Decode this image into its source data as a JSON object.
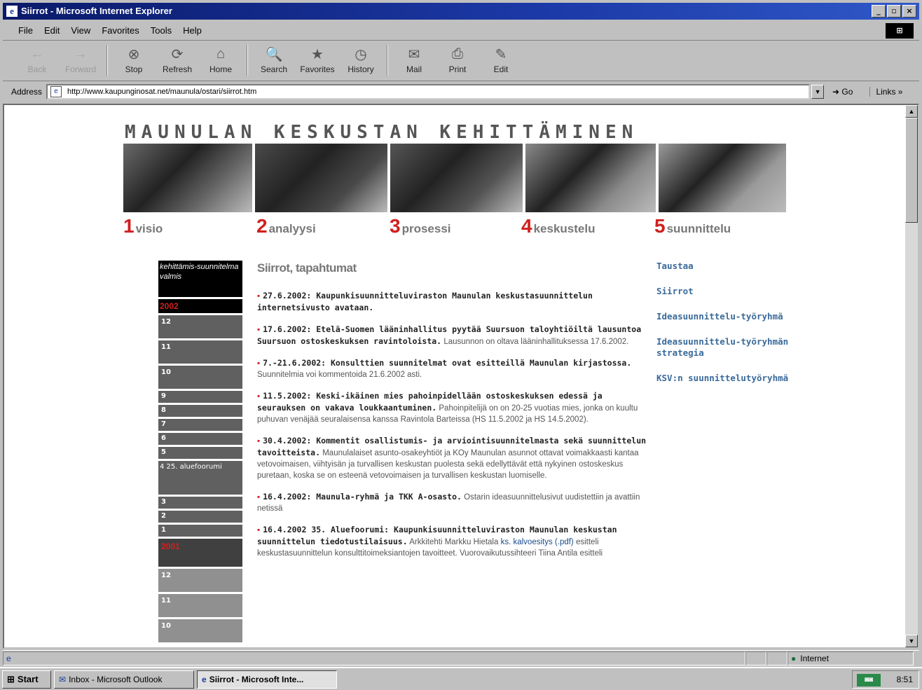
{
  "window": {
    "title": "Siirrot - Microsoft Internet Explorer",
    "controls": [
      "_",
      "▫",
      "×"
    ]
  },
  "menu": [
    "File",
    "Edit",
    "View",
    "Favorites",
    "Tools",
    "Help"
  ],
  "toolbar": [
    {
      "label": "Back",
      "icon": "back-arrow-icon",
      "glyph": "←",
      "enabled": false
    },
    {
      "label": "Forward",
      "icon": "forward-arrow-icon",
      "glyph": "→",
      "enabled": false
    },
    {
      "label": "Stop",
      "icon": "stop-icon",
      "glyph": "⊗",
      "enabled": true
    },
    {
      "label": "Refresh",
      "icon": "refresh-icon",
      "glyph": "⟳",
      "enabled": true
    },
    {
      "label": "Home",
      "icon": "home-icon",
      "glyph": "⌂",
      "enabled": true
    },
    {
      "label": "Search",
      "icon": "search-icon",
      "glyph": "🔍",
      "enabled": true
    },
    {
      "label": "Favorites",
      "icon": "favorites-icon",
      "glyph": "★",
      "enabled": true
    },
    {
      "label": "History",
      "icon": "history-icon",
      "glyph": "◷",
      "enabled": true
    },
    {
      "label": "Mail",
      "icon": "mail-icon",
      "glyph": "✉",
      "enabled": true
    },
    {
      "label": "Print",
      "icon": "print-icon",
      "glyph": "⎙",
      "enabled": true
    },
    {
      "label": "Edit",
      "icon": "edit-icon",
      "glyph": "✎",
      "enabled": true
    }
  ],
  "address": {
    "label": "Address",
    "url": "http://www.kaupunginosat.net/maunula/ostari/siirrot.htm",
    "go": "Go",
    "links": "Links »"
  },
  "page": {
    "headline": "MAUNULAN KESKUSTAN KEHITTÄMINEN",
    "photos": [
      {
        "desc": "shopping centre exterior",
        "color": "#6a6a6a"
      },
      {
        "desc": "interior corridor",
        "color": "#4a4a4a"
      },
      {
        "desc": "meeting audience",
        "color": "#555555"
      },
      {
        "desc": "computer screen",
        "color": "#8a8a8a"
      },
      {
        "desc": "aerial map",
        "color": "#9a9a9a"
      }
    ],
    "steps": [
      {
        "num": "1",
        "label": "visio"
      },
      {
        "num": "2",
        "label": "analyysi"
      },
      {
        "num": "3",
        "label": "prosessi"
      },
      {
        "num": "4",
        "label": "keskustelu"
      },
      {
        "num": "5",
        "label": "suunnittelu"
      }
    ],
    "leftnav": {
      "top": "kehittämis-suunnitelma valmis",
      "year1": "2002",
      "months": [
        "12",
        "11",
        "10",
        "9",
        "8",
        "7",
        "6",
        "5"
      ],
      "month4": "4 25. aluefoorumi",
      "after": [
        "3",
        "2",
        "1"
      ],
      "year2": "2001",
      "months2": [
        "12",
        "11",
        "10"
      ]
    },
    "title": "Siirrot, tapahtumat",
    "news": [
      {
        "bold": "27.6.2002: Kaupunkisuunnitteluviraston Maunulan keskustasuunnittelun internetsivusto avataan.",
        "desc": ""
      },
      {
        "bold": "17.6.2002: Etelä-Suomen lääninhallitus pyytää Suursuon taloyhtiöiltä lausuntoa Suursuon ostoskeskuksen ravintoloista.",
        "desc": "Lausunnon on oltava lääninhallituksessa 17.6.2002."
      },
      {
        "bold": "7.-21.6.2002: Konsulttien suunnitelmat ovat esitteillä Maunulan kirjastossa.",
        "desc": "Suunnitelmia voi kommentoida 21.6.2002 asti."
      },
      {
        "bold": "11.5.2002: Keski-ikäinen mies pahoinpidellään ostoskeskuksen edessä ja seurauksen on vakava loukkaantuminen.",
        "desc": "Pahoinpitelijä on on 20-25 vuotias mies, jonka on kuultu puhuvan venäjää seuralaisensa kanssa Ravintola Barteissa (HS 11.5.2002 ja HS 14.5.2002)."
      },
      {
        "bold": "30.4.2002: Kommentit osallistumis- ja arviointisuunnitelmasta sekä suunnittelun tavoitteista.",
        "desc": "Maunulalaiset asunto-osakeyhtiöt ja KOy Maunulan asunnot ottavat voimakkaasti kantaa vetovoimaisen, viihtyisän ja turvallisen keskustan puolesta sekä edellyttävät että nykyinen ostoskeskus puretaan, koska se on esteenä vetovoimaisen ja turvallisen keskustan luomiselle."
      },
      {
        "bold": "16.4.2002: Maunula-ryhmä ja TKK A-osasto.",
        "desc": "Ostarin ideasuunnittelusivut uudistettiin ja avattiin netissä"
      },
      {
        "bold": "16.4.2002 35. Aluefoorumi: Kaupunkisuunnitteluviraston Maunulan keskustan suunnittelun tiedotustilaisuus.",
        "desc": "Arkkitehti Markku Hietala",
        "link": "ks. kalvoesitys (.pdf)",
        "desc2": "esitteli keskustasuunnittelun konsulttitoimeksiantojen tavoitteet. Vuorovaikutussihteeri Tiina Antila esitteli"
      }
    ],
    "rightnav": [
      "Taustaa",
      "Siirrot",
      "Ideasuunnittelu-työryhmä",
      "Ideasuunnittelu-työryhmän strategia",
      "KSV:n suunnittelutyöryhmä"
    ]
  },
  "status": {
    "zone": "Internet"
  },
  "taskbar": {
    "start": "Start",
    "tasks": [
      {
        "label": "Inbox - Microsoft Outlook",
        "active": false
      },
      {
        "label": "Siirrot - Microsoft Inte...",
        "active": true
      }
    ],
    "clock": "8:51"
  }
}
